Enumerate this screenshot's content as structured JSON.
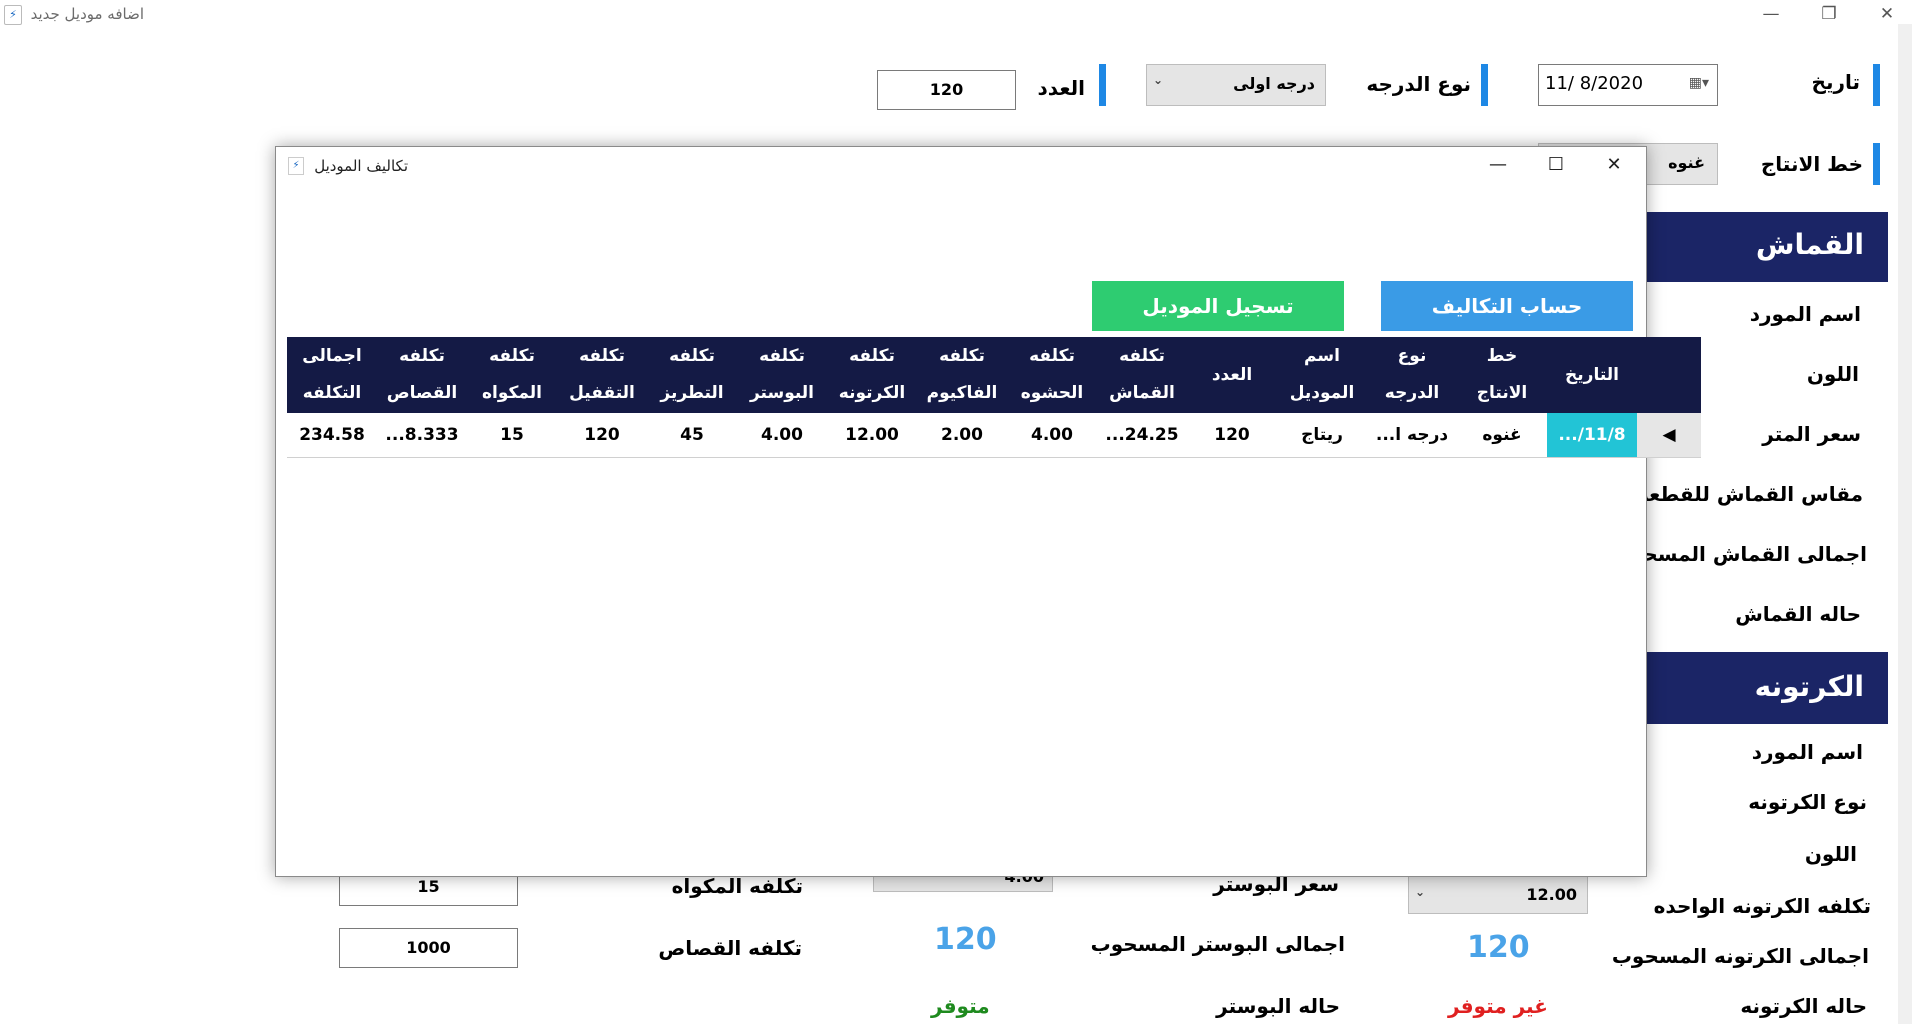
{
  "window": {
    "title": "اضافه موديل جديد"
  },
  "top_form": {
    "date_label": "تاريخ",
    "date_value": "11/  8/2020",
    "grade_type_label": "نوع الدرجه",
    "grade_type_value": "درجه اولى",
    "count_label": "العدد",
    "count_value": "120",
    "production_line_label": "خط الانتاج",
    "production_line_value": "غنوه"
  },
  "fabric_section": {
    "title": "القماش",
    "fields": [
      "اسم المورد",
      "اللون",
      "سعر المتر",
      "مقاس القماش للقطعه",
      "اجمالى القماش المسحوب",
      "حاله القماش"
    ]
  },
  "carton_section": {
    "title": "الكرتونه",
    "fields": [
      "اسم المورد",
      "نوع الكرتونه",
      "اللون",
      "تكلفه الكرتونه الواحده",
      "اجمالى الكرتونه المسحوب",
      "حاله الكرتونه"
    ],
    "unit_cost_value": "12.00",
    "total_drawn_value": "120",
    "status_value": "غير متوفر"
  },
  "poster_section": {
    "price_label": "سعر البوستر",
    "price_value": "4.00",
    "total_drawn_label": "اجمالى البوستر المسحوب",
    "total_drawn_value": "120",
    "status_label": "حاله البوستر",
    "status_value": "متوفر"
  },
  "other_costs": {
    "ironing_cost_label": "تكلفه المكواه",
    "ironing_cost_value": "15",
    "cutter_cost_label": "تكلفه القصاص",
    "cutter_cost_value": "1000"
  },
  "colors": {
    "section_bar": "#1b2566",
    "accent_blue": "#1e88e5",
    "available": "#1e8a1e",
    "unavailable": "#e02020",
    "calc_button": "#3a9be6",
    "save_button": "#2ecc71"
  },
  "modal": {
    "title": "تكاليف الموديل",
    "calc_button": "حساب التكاليف",
    "save_button": "تسجيل الموديل",
    "columns": [
      [
        "التاريخ",
        ""
      ],
      [
        "خط",
        "الانتاج"
      ],
      [
        "نوع",
        "الدرجه"
      ],
      [
        "اسم",
        "الموديل"
      ],
      [
        "العدد",
        ""
      ],
      [
        "تكلفه",
        "القماش"
      ],
      [
        "تكلفه",
        "الحشوه"
      ],
      [
        "تكلفه",
        "الفاكيوم"
      ],
      [
        "تكلفه",
        "الكرتونه"
      ],
      [
        "تكلفه",
        "البوستر"
      ],
      [
        "تكلفه",
        "التطريز"
      ],
      [
        "تكلفه",
        "التقفيل"
      ],
      [
        "تكلفه",
        "المكواه"
      ],
      [
        "تكلفه",
        "القصاص"
      ],
      [
        "اجمالى",
        "التكلفه"
      ]
    ],
    "row": [
      "11/8/...",
      "غنوه",
      "درجه ا...",
      "ريتاج",
      "120",
      "24.25...",
      "4.00",
      "2.00",
      "12.00",
      "4.00",
      "45",
      "120",
      "15",
      "8.333...",
      "234.58"
    ]
  }
}
